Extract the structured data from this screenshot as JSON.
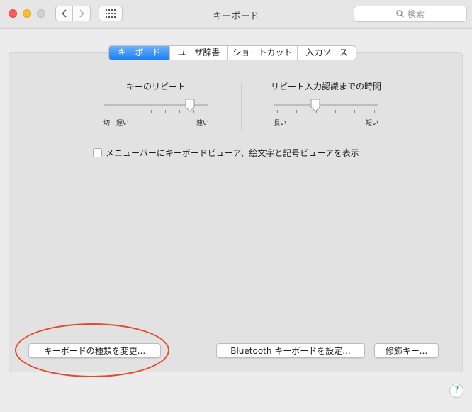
{
  "window": {
    "title": "キーボード",
    "search_placeholder": "検索"
  },
  "tabs": [
    {
      "label": "キーボード",
      "active": true
    },
    {
      "label": "ユーザ辞書",
      "active": false
    },
    {
      "label": "ショートカット",
      "active": false
    },
    {
      "label": "入力ソース",
      "active": false
    }
  ],
  "key_repeat": {
    "label": "キーのリピート",
    "left_labels": [
      "切",
      "遅い"
    ],
    "right_label": "速い",
    "level": 0.83
  },
  "delay_until_repeat": {
    "label": "リピート入力認識までの時間",
    "left_label": "長い",
    "right_label": "短い",
    "level": 0.4
  },
  "viewer_checkbox": {
    "label": "メニューバーにキーボードビューア、絵文字と記号ビューアを表示",
    "checked": false
  },
  "buttons": {
    "change_type": "キーボードの種類を変更...",
    "bluetooth": "Bluetooth キーボードを設定...",
    "modifier": "修飾キー...",
    "help": "?"
  },
  "colors": {
    "accent": "#1d7ff5",
    "annotation": "#e8492b"
  }
}
